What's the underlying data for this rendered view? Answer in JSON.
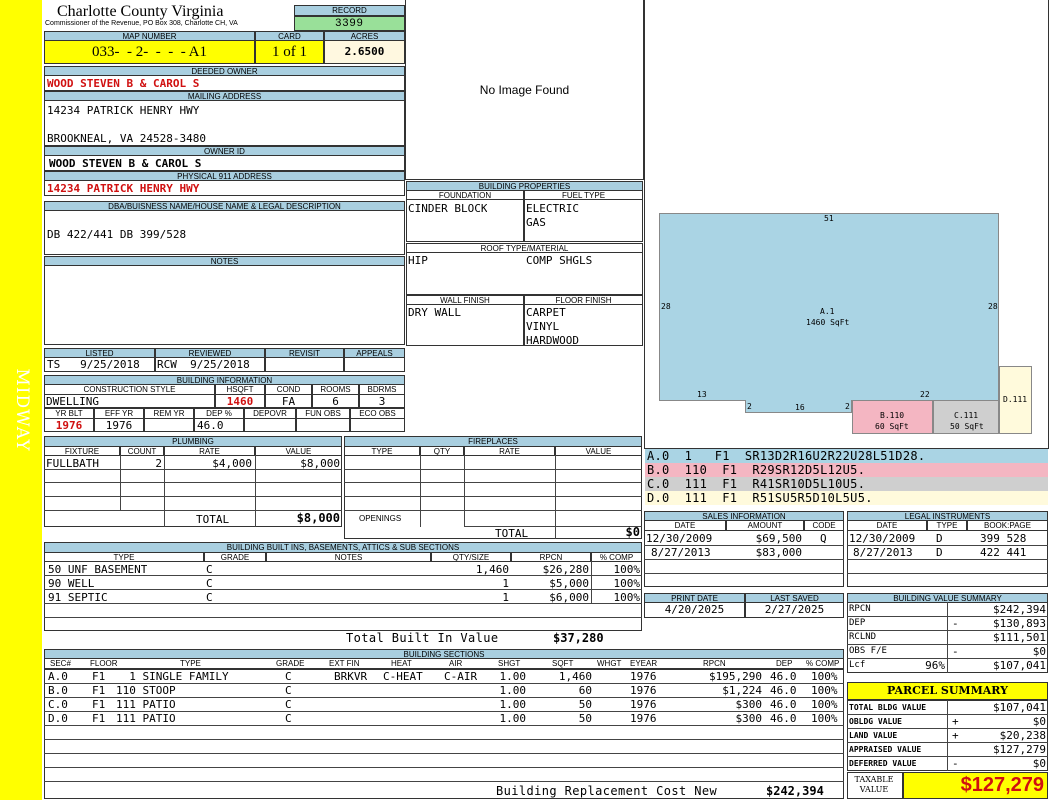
{
  "sidebar": {
    "label": "MIDWAY"
  },
  "county": {
    "title": "Charlotte County Virginia",
    "subtitle": "Commissioner of the Revenue, PO Box 308, Charlotte CH, VA"
  },
  "record": {
    "label": "RECORD",
    "value": "3399"
  },
  "map": {
    "label": "MAP NUMBER",
    "value": "033-  - 2-  -  -  - A1",
    "card_label": "CARD",
    "card_value": "1 of 1",
    "acres_label": "ACRES",
    "acres_value": "2.6500"
  },
  "owner": {
    "deeded_label": "DEEDED OWNER",
    "deeded": "WOOD STEVEN B & CAROL S",
    "mailing_label": "MAILING ADDRESS",
    "mail1": "14234 PATRICK HENRY HWY",
    "mail2": "BROOKNEAL, VA 24528-3480",
    "id_label": "OWNER ID",
    "id_value": "WOOD STEVEN B & CAROL S",
    "phys_label": "PHYSICAL 911 ADDRESS",
    "phys": "14234 PATRICK HENRY HWY"
  },
  "dba": {
    "label": "DBA/BUISNESS NAME/HOUSE NAME & LEGAL DESCRIPTION",
    "value": "DB 422/441 DB 399/528"
  },
  "notes": {
    "label": "NOTES"
  },
  "image": {
    "text": "No Image Found"
  },
  "props": {
    "label": "BUILDING PROPERTIES",
    "foundation_label": "FOUNDATION",
    "foundation": "CINDER BLOCK",
    "fuel_label": "FUEL TYPE",
    "fuel1": "ELECTRIC",
    "fuel2": "GAS",
    "roof_label": "ROOF TYPE/MATERIAL",
    "roof_type": "HIP",
    "roof_mat": "COMP SHGLS",
    "wall_label": "WALL FINISH",
    "wall": "DRY WALL",
    "floor_label": "FLOOR FINISH",
    "floor1": "CARPET",
    "floor2": "VINYL",
    "floor3": "HARDWOOD"
  },
  "listing": {
    "listed_label": "LISTED",
    "listed": "TS   9/25/2018",
    "reviewed_label": "REVIEWED",
    "reviewed": "RCW  9/25/2018",
    "revisit_label": "REVISIT",
    "appeals_label": "APPEALS"
  },
  "bldg": {
    "label": "BUILDING INFORMATION",
    "style_label": "CONSTRUCTION STYLE",
    "style": "DWELLING",
    "hsqft_label": "HSQFT",
    "hsqft": "1460",
    "cond_label": "COND",
    "cond": "FA",
    "rooms_label": "ROOMS",
    "rooms": "6",
    "bdrms_label": "BDRMS",
    "bdrms": "3",
    "yrblt_label": "YR BLT",
    "yrblt": "1976",
    "effyr_label": "EFF YR",
    "effyr": "1976",
    "remyr_label": "REM YR",
    "dep_label": "DEP %",
    "dep": "46.0",
    "depovr_label": "DEPOVR",
    "funobs_label": "FUN OBS",
    "ecoobs_label": "ECO OBS"
  },
  "plumbing": {
    "label": "PLUMBING",
    "h_fixture": "FIXTURE",
    "h_count": "COUNT",
    "h_rate": "RATE",
    "h_value": "VALUE",
    "fixture": "FULLBATH",
    "count": "2",
    "rate": "$4,000",
    "value": "$8,000",
    "total_label": "TOTAL",
    "total": "$8,000"
  },
  "fireplaces": {
    "label": "FIREPLACES",
    "h_type": "TYPE",
    "h_qty": "QTY",
    "h_rate": "RATE",
    "h_value": "VALUE",
    "openings": "OPENINGS",
    "total_label": "TOTAL",
    "total": "$0"
  },
  "builtins": {
    "label": "BUILDING BUILT INS, BASEMENTS, ATTICS & SUB SECTIONS",
    "h_type": "TYPE",
    "h_grade": "GRADE",
    "h_notes": "NOTES",
    "h_qty": "QTY/SIZE",
    "h_rpcn": "RPCN",
    "h_comp": "% COMP",
    "rows": [
      {
        "type": "50 UNF BASEMENT",
        "grade": "C",
        "qty": "1,460",
        "rpcn": "$26,280",
        "comp": "100%"
      },
      {
        "type": "90 WELL",
        "grade": "C",
        "qty": "1",
        "rpcn": "$5,000",
        "comp": "100%"
      },
      {
        "type": "91 SEPTIC",
        "grade": "C",
        "qty": "1",
        "rpcn": "$6,000",
        "comp": "100%"
      }
    ],
    "total_label": "Total Built In Value",
    "total": "$37,280"
  },
  "sections": {
    "label": "BUILDING SECTIONS",
    "h_sec": "SEC#",
    "h_floor": "FLOOR",
    "h_type": "TYPE",
    "h_grade": "GRADE",
    "h_extfin": "EXT FIN",
    "h_heat": "HEAT",
    "h_air": "AIR",
    "h_shgt": "SHGT",
    "h_sqft": "SQFT",
    "h_whgt": "WHGT",
    "h_eyear": "EYEAR",
    "h_rpcn": "RPCN",
    "h_dep": "DEP",
    "h_comp": "% COMP",
    "rows": [
      {
        "sec": "A.0",
        "floor": "F1",
        "type": "  1 SINGLE FAMILY",
        "grade": "C",
        "extfin": "BRKVR",
        "heat": "C-HEAT",
        "air": "C-AIR",
        "shgt": "1.00",
        "sqft": "1,460",
        "eyear": "1976",
        "rpcn": "$195,290",
        "dep": "46.0",
        "comp": "100%"
      },
      {
        "sec": "B.0",
        "floor": "F1",
        "type": "110 STOOP",
        "grade": "C",
        "extfin": "",
        "heat": "",
        "air": "",
        "shgt": "1.00",
        "sqft": "60",
        "eyear": "1976",
        "rpcn": "$1,224",
        "dep": "46.0",
        "comp": "100%"
      },
      {
        "sec": "C.0",
        "floor": "F1",
        "type": "111 PATIO",
        "grade": "C",
        "extfin": "",
        "heat": "",
        "air": "",
        "shgt": "1.00",
        "sqft": "50",
        "eyear": "1976",
        "rpcn": "$300",
        "dep": "46.0",
        "comp": "100%"
      },
      {
        "sec": "D.0",
        "floor": "F1",
        "type": "111 PATIO",
        "grade": "C",
        "extfin": "",
        "heat": "",
        "air": "",
        "shgt": "1.00",
        "sqft": "50",
        "eyear": "1976",
        "rpcn": "$300",
        "dep": "46.0",
        "comp": "100%"
      }
    ],
    "total_label": "Building Replacement Cost New",
    "total": "$242,394"
  },
  "sketch": {
    "a_label": "A.1",
    "a_area": "1460 SqFt",
    "b_label": "B.110",
    "b_area": "60 SqFt",
    "c_label": "C.111",
    "c_area": "50 SqFt",
    "d_label": "D.111",
    "dim_top": "51",
    "dim_left": "28",
    "dim_right": "28",
    "dim_13": "13",
    "dim_2a": "2",
    "dim_16": "16",
    "dim_2b": "2",
    "dim_22": "22",
    "colors": {
      "a": "#aad4e4",
      "b": "#f4b6c2",
      "c": "#cfcfcf",
      "d": "#fffadc"
    }
  },
  "vectors": [
    {
      "text": "A.0  1   F1  SR13D2R16U2R22U28L51D28.",
      "color": "#aad4e4"
    },
    {
      "text": "B.0  110  F1  R29SR12D5L12U5.",
      "color": "#f4b6c2"
    },
    {
      "text": "C.0  111  F1  R41SR10D5L10U5.",
      "color": "#cfcfcf"
    },
    {
      "text": "D.0  111  F1  R51SU5R5D10L5U5.",
      "color": "#fffadc"
    }
  ],
  "sales": {
    "label": "SALES INFORMATION",
    "h_date": "DATE",
    "h_amount": "AMOUNT",
    "h_code": "CODE",
    "rows": [
      {
        "date": "12/30/2009",
        "amount": "$69,500",
        "code": "Q"
      },
      {
        "date": "8/27/2013",
        "amount": "$83,000",
        "code": ""
      }
    ]
  },
  "legal": {
    "label": "LEGAL INSTRUMENTS",
    "h_date": "DATE",
    "h_type": "TYPE",
    "h_book": "BOOK:PAGE",
    "rows": [
      {
        "date": "12/30/2009",
        "type": "D",
        "book": "399 528"
      },
      {
        "date": "8/27/2013",
        "type": "D",
        "book": "422 441"
      }
    ]
  },
  "print": {
    "print_label": "PRINT DATE",
    "print_date": "4/20/2025",
    "saved_label": "LAST SAVED",
    "saved_date": "2/27/2025"
  },
  "value_summary": {
    "label": "BUILDING VALUE SUMMARY",
    "rows": [
      {
        "k": "RPCN",
        "sign": "",
        "v": "$242,394"
      },
      {
        "k": "DEP",
        "sign": "-",
        "v": "$130,893"
      },
      {
        "k": "RCLND",
        "sign": "",
        "v": "$111,501"
      },
      {
        "k": "OBS F/E",
        "sign": "-",
        "v": "$0"
      },
      {
        "k": "Lcf",
        "pct": "96%",
        "sign": "",
        "v": "$107,041"
      }
    ]
  },
  "parcel": {
    "label": "PARCEL SUMMARY",
    "rows": [
      {
        "k": "TOTAL BLDG VALUE",
        "sign": "",
        "v": "$107,041"
      },
      {
        "k": "OBLDG VALUE",
        "sign": "+",
        "v": "$0"
      },
      {
        "k": "LAND VALUE",
        "sign": "+",
        "v": "$20,238"
      },
      {
        "k": "APPRAISED VALUE",
        "sign": "",
        "v": "$127,279"
      },
      {
        "k": "DEFERRED VALUE",
        "sign": "-",
        "v": "$0"
      }
    ],
    "taxable_label": "TAXABLE VALUE",
    "taxable": "$127,279",
    "color": "#ffff00",
    "taxable_color": "#d01010"
  }
}
